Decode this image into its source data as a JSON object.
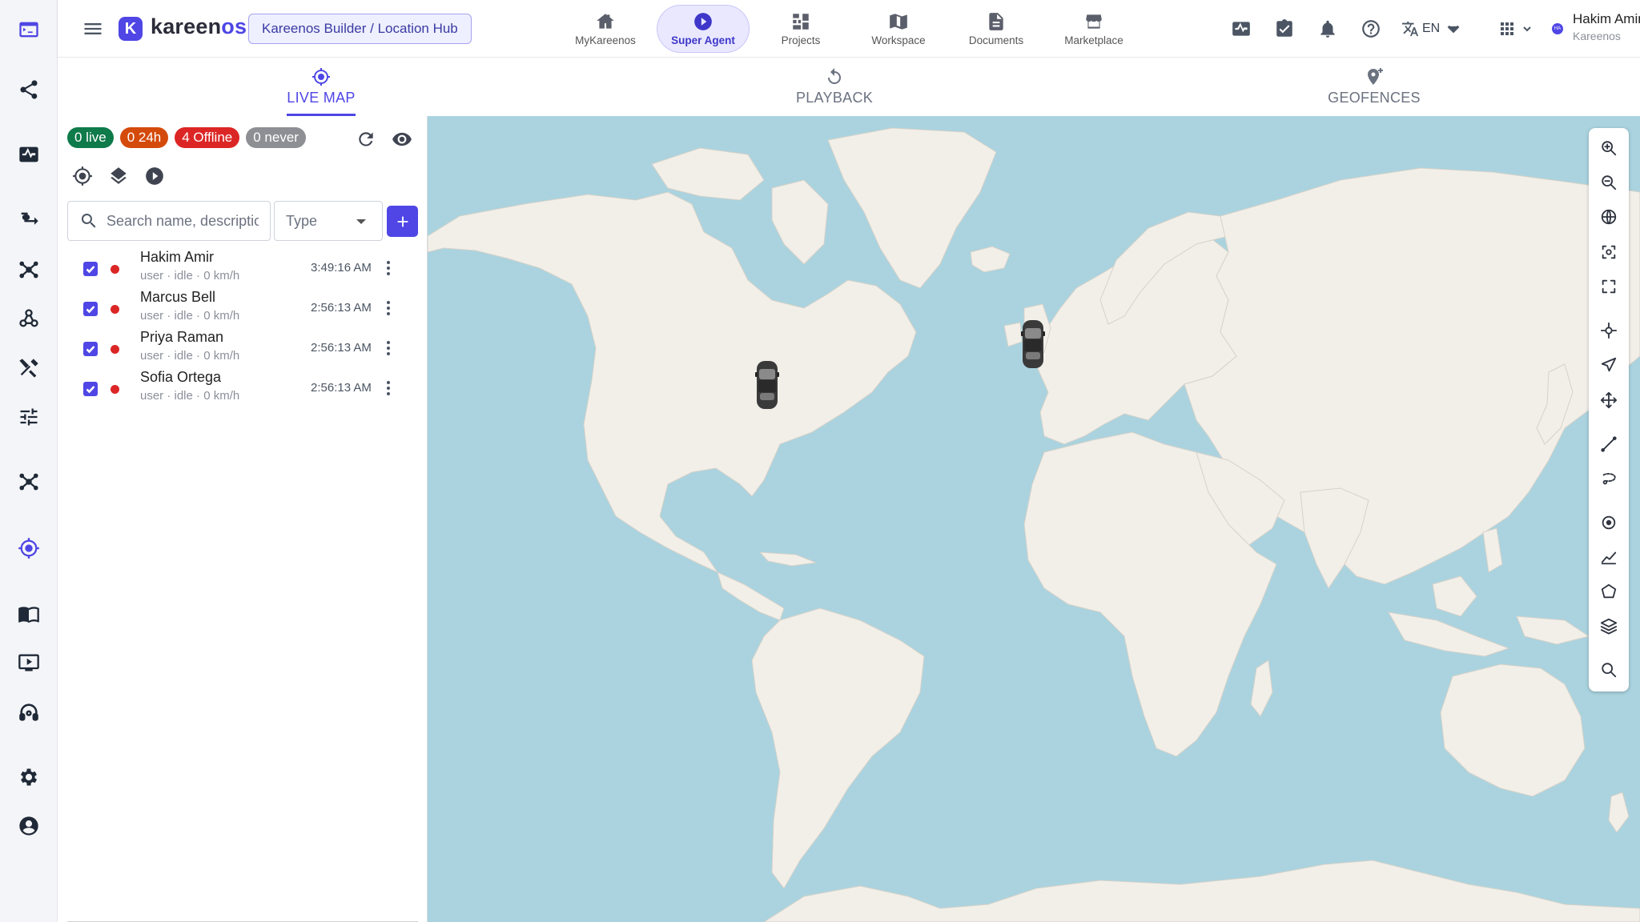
{
  "header": {
    "brand_main": "kareen",
    "brand_accent": "os",
    "logo_letter": "K",
    "breadcrumb": "Kareenos Builder / Location Hub",
    "nav": [
      {
        "label": "MyKareenos",
        "icon": "home-icon",
        "active": false
      },
      {
        "label": "Super Agent",
        "icon": "play-circle-icon",
        "active": true
      },
      {
        "label": "Projects",
        "icon": "projects-icon",
        "active": false
      },
      {
        "label": "Workspace",
        "icon": "workspace-icon",
        "active": false
      },
      {
        "label": "Documents",
        "icon": "document-icon",
        "active": false
      },
      {
        "label": "Marketplace",
        "icon": "store-icon",
        "active": false
      }
    ],
    "language": "EN",
    "user": {
      "name": "Hakim Amir",
      "org": "Kareenos",
      "initials": "HA"
    }
  },
  "tabs": [
    {
      "label": "LIVE MAP",
      "icon": "target-icon",
      "active": true
    },
    {
      "label": "PLAYBACK",
      "icon": "replay-icon",
      "active": false
    },
    {
      "label": "GEOFENCES",
      "icon": "geofence-pin-icon",
      "active": false
    }
  ],
  "status_chips": {
    "live": "0 live",
    "h24": "0 24h",
    "offline": "4 Offline",
    "never": "0 never"
  },
  "search": {
    "placeholder": "Search name, description"
  },
  "type_filter": {
    "placeholder": "Type"
  },
  "users": [
    {
      "name": "Hakim Amir",
      "sub": "user · idle · 0 km/h",
      "time": "3:49:16 AM",
      "checked": true,
      "status_color": "#dc2626"
    },
    {
      "name": "Marcus Bell",
      "sub": "user · idle · 0 km/h",
      "time": "2:56:13 AM",
      "checked": true,
      "status_color": "#dc2626"
    },
    {
      "name": "Priya Raman",
      "sub": "user · idle · 0 km/h",
      "time": "2:56:13 AM",
      "checked": true,
      "status_color": "#dc2626"
    },
    {
      "name": "Sofia Ortega",
      "sub": "user · idle · 0 km/h",
      "time": "2:56:13 AM",
      "checked": true,
      "status_color": "#dc2626"
    }
  ],
  "colors": {
    "accent": "#4f46e5",
    "live": "#0f7a4a",
    "h24": "#d44a0a",
    "offline": "#dc2626",
    "never": "#8d8f94",
    "water": "#aad3df",
    "land": "#f2efe9"
  },
  "map_tools": [
    "zoom-in-icon",
    "zoom-out-icon",
    "globe-icon",
    "focus-icon",
    "fullscreen-icon",
    "crosshair-icon",
    "navigate-icon",
    "pan-icon",
    "measure-line-icon",
    "lasso-icon",
    "point-icon",
    "chart-line-icon",
    "polygon-icon",
    "layers-icon",
    "search-zoom-icon"
  ]
}
